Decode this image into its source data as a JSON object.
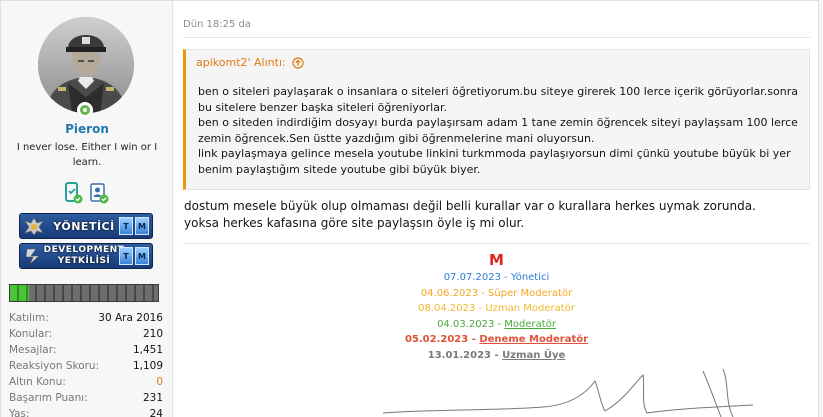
{
  "user": {
    "name": "Pieron",
    "title": "I never lose. Either I win or I learn.",
    "ranks": [
      {
        "label": "YÖNETİCİ",
        "tm": [
          "T",
          "M"
        ]
      },
      {
        "label": "DEVELOPMENT YETKİLİSİ",
        "tm": [
          "T",
          "M"
        ]
      }
    ],
    "progress_fraction": 0.13,
    "stats": [
      {
        "key": "Katılım:",
        "value": "30 Ara 2016"
      },
      {
        "key": "Konular:",
        "value": "210"
      },
      {
        "key": "Mesajlar:",
        "value": "1,451"
      },
      {
        "key": "Reaksiyon Skoru:",
        "value": "1,109"
      },
      {
        "key": "Altın Konu:",
        "value": "0"
      },
      {
        "key": "Başarım Puanı:",
        "value": "231"
      },
      {
        "key": "Yaş:",
        "value": "24"
      }
    ]
  },
  "post": {
    "date": "Dün 18:25 da",
    "quote": {
      "author": "apikomt2' Alıntı:",
      "lines": [
        "ben o siteleri paylaşarak o insanlara o siteleri öğretiyorum.bu siteye girerek 100 lerce içerik görüyorlar.sonra bu sitelere benzer başka siteleri öğreniyorlar.",
        "ben o siteden indirdiğim dosyayı burda paylaşırsam adam 1 tane zemin öğrencek siteyi paylaşsam 100 lerce zemin öğrencek.Sen üstte yazdığım gibi öğrenmelerine mani oluyorsun.",
        "link paylaşmaya gelince mesela youtube linkini turkmmoda paylaşıyorsun dimi çünkü youtube büyük bi yer benim paylaştığım sitede youtube gibi büyük biyer."
      ]
    },
    "text": [
      "dostum mesele büyük olup olmaması değil belli kurallar var o kurallara herkes uymak zorunda.",
      "yoksa herkes kafasına göre site paylaşsın öyle iş mi olur."
    ]
  },
  "signature": {
    "mark": "M",
    "history": [
      {
        "date": "07.07.2023",
        "role": "Yönetici",
        "color": "#2b7bd0"
      },
      {
        "date": "04.06.2023",
        "role": "Süper Moderatör",
        "color": "#f5a623"
      },
      {
        "date": "08.04.2023",
        "role": "Uzman Moderatör",
        "color": "#f0b832"
      },
      {
        "date": "04.03.2023",
        "role": "Moderatör",
        "color": "#4aa83c"
      },
      {
        "date": "05.02.2023",
        "role": "Deneme Moderatör",
        "color": "#e0503a"
      },
      {
        "date": "13.01.2023",
        "role": "Uzman Üye",
        "color": "#7a7a7a"
      }
    ]
  },
  "icons": {
    "online": "online-status-icon",
    "badge1": "phone-check-icon",
    "badge2": "id-card-check-icon",
    "quote_jump": "arrow-up-circle-icon"
  }
}
